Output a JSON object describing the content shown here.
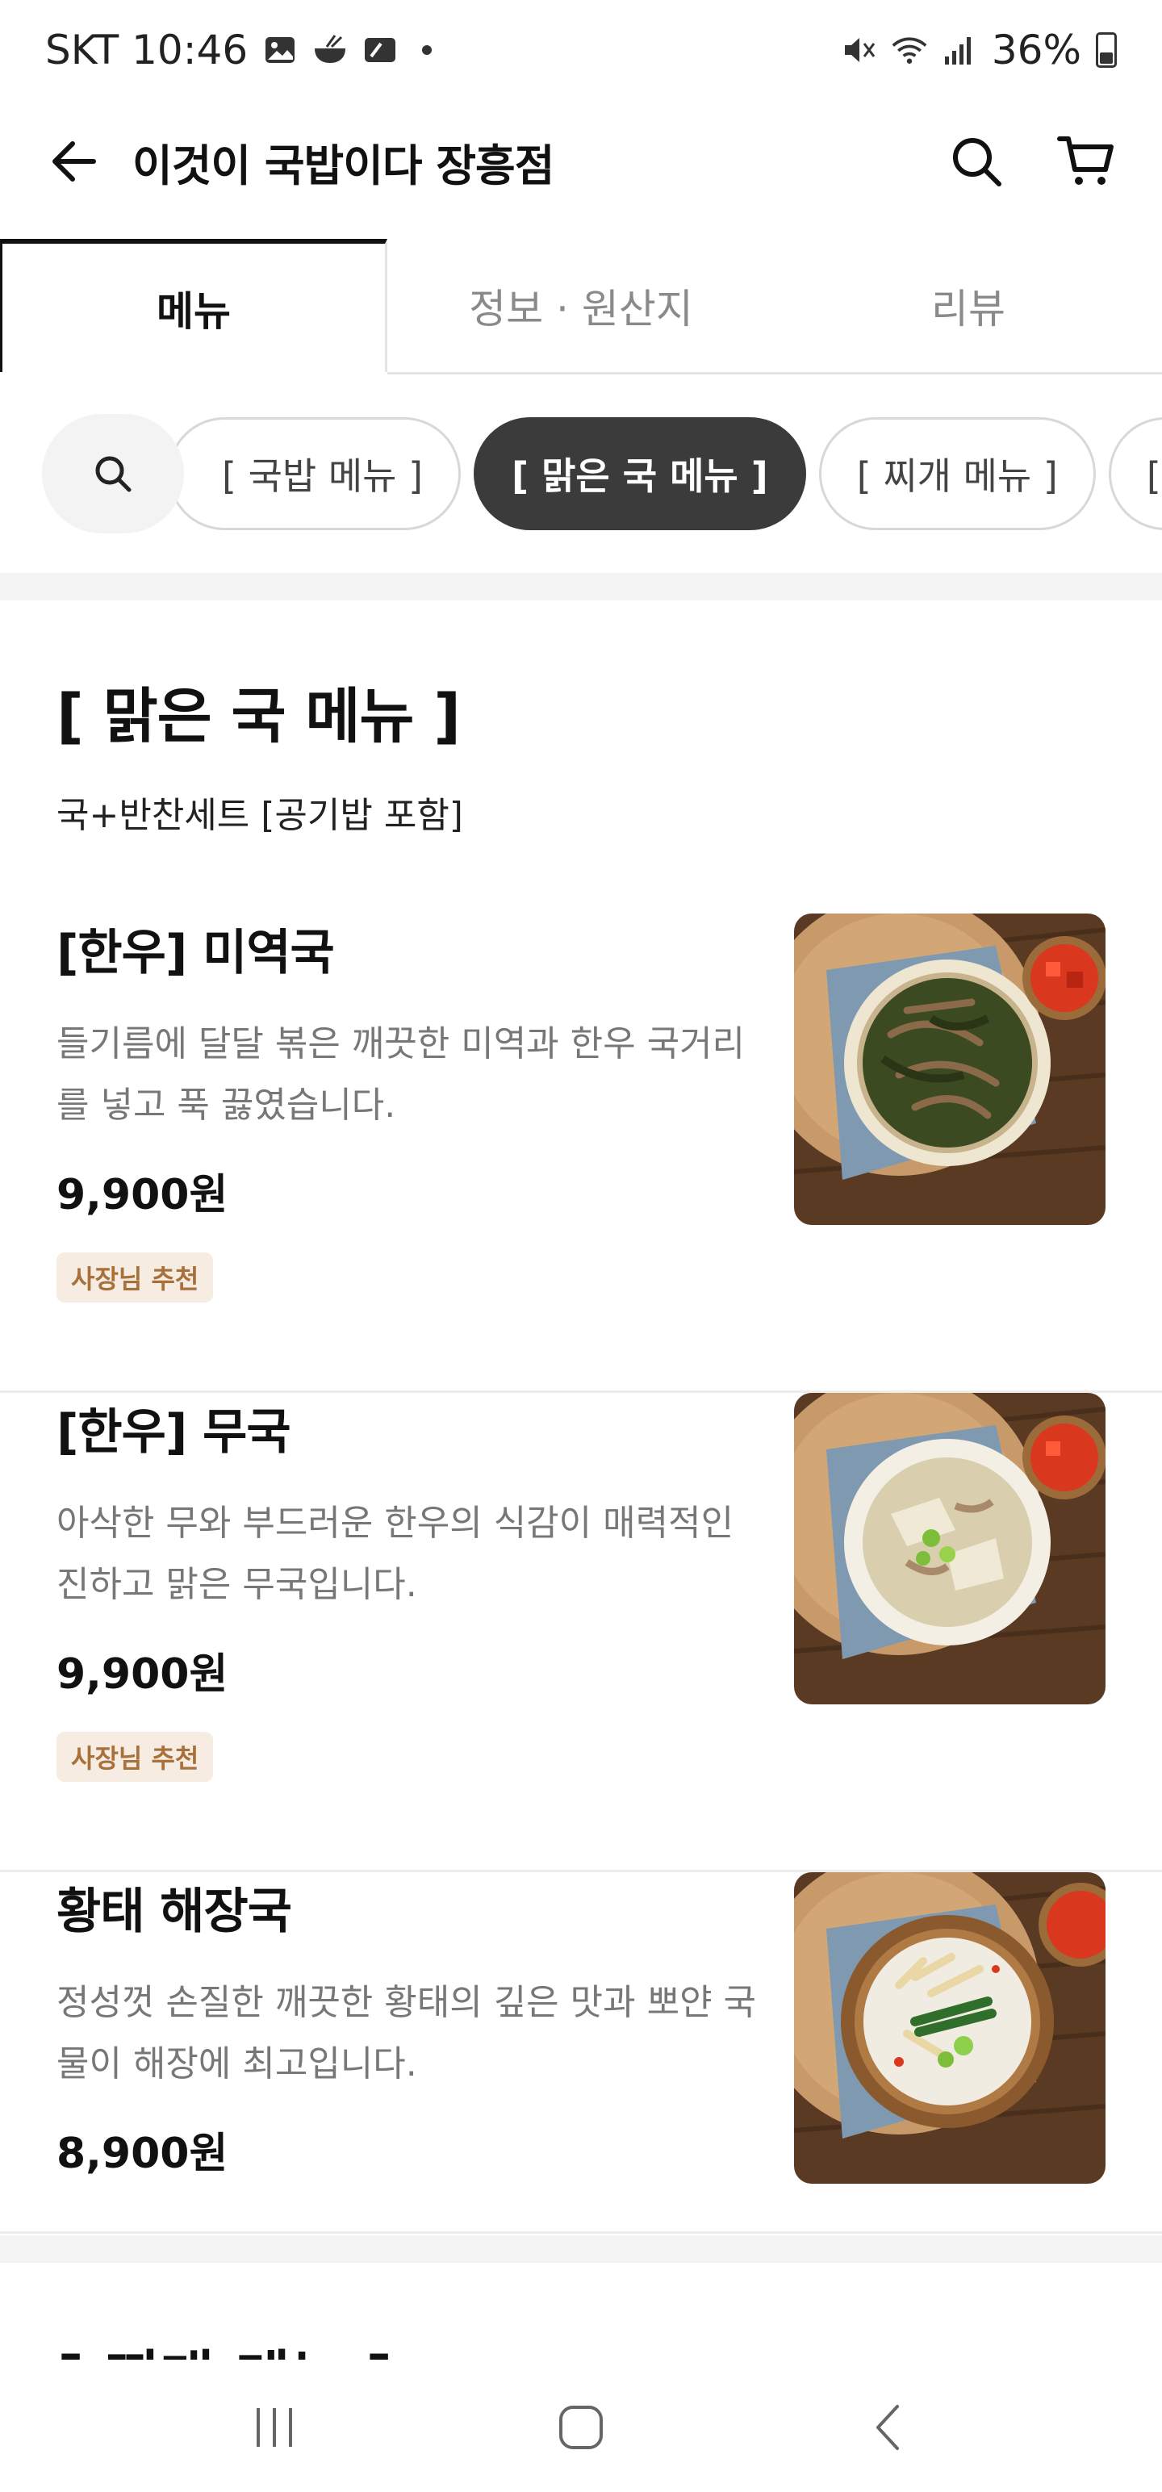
{
  "status_bar": {
    "carrier_time": "SKT 10:46",
    "battery": "36%",
    "icons": [
      "gallery-icon",
      "bowl-icon",
      "card-icon",
      "mute-icon",
      "wifi-icon",
      "signal-icon",
      "battery-icon"
    ]
  },
  "header": {
    "title": "이것이 국밥이다 장흥점",
    "icons": [
      "back-arrow-icon",
      "search-icon",
      "cart-icon"
    ]
  },
  "tabs": [
    {
      "label": "메뉴",
      "active": true
    },
    {
      "label": "정보 · 원산지",
      "active": false
    },
    {
      "label": "리뷰",
      "active": false
    }
  ],
  "categories": [
    {
      "label": "[ 국밥 메뉴 ]",
      "active": false
    },
    {
      "label": "[ 맑은 국 메뉴 ]",
      "active": true
    },
    {
      "label": "[ 찌개 메뉴 ]",
      "active": false
    },
    {
      "label": "[ 탕 메뉴 ]",
      "active": false
    }
  ],
  "section": {
    "title": "[ 맑은 국 메뉴 ]",
    "subtitle": "국+반찬세트 [공기밥 포함]"
  },
  "items": [
    {
      "name": "[한우] 미역국",
      "description": "들기름에 달달 볶은 깨끗한 미역과 한우 국거리를 넣고 푹 끓였습니다.",
      "price": "9,900원",
      "badge": "사장님 추천",
      "photo": "seaweed-soup-photo"
    },
    {
      "name": "[한우] 무국",
      "description": "아삭한 무와 부드러운 한우의 식감이 매력적인 진하고 맑은 무국입니다.",
      "price": "9,900원",
      "badge": "사장님 추천",
      "photo": "radish-soup-photo"
    },
    {
      "name": "황태 해장국",
      "description": "정성껏 손질한 깨끗한 황태의 깊은 맛과 뽀얀 국물이 해장에 최고입니다.",
      "price": "8,900원",
      "badge": "",
      "photo": "pollack-soup-photo"
    }
  ],
  "next_section": {
    "title": "[ 찌개 메뉴 ]"
  },
  "nav_bar": {
    "icons": [
      "recent-apps-icon",
      "home-icon",
      "back-icon"
    ]
  },
  "colors": {
    "accent_chip": "#3b3b3b",
    "badge_bg": "#f6ece2",
    "badge_text": "#a8703a",
    "divider": "#ededed"
  }
}
